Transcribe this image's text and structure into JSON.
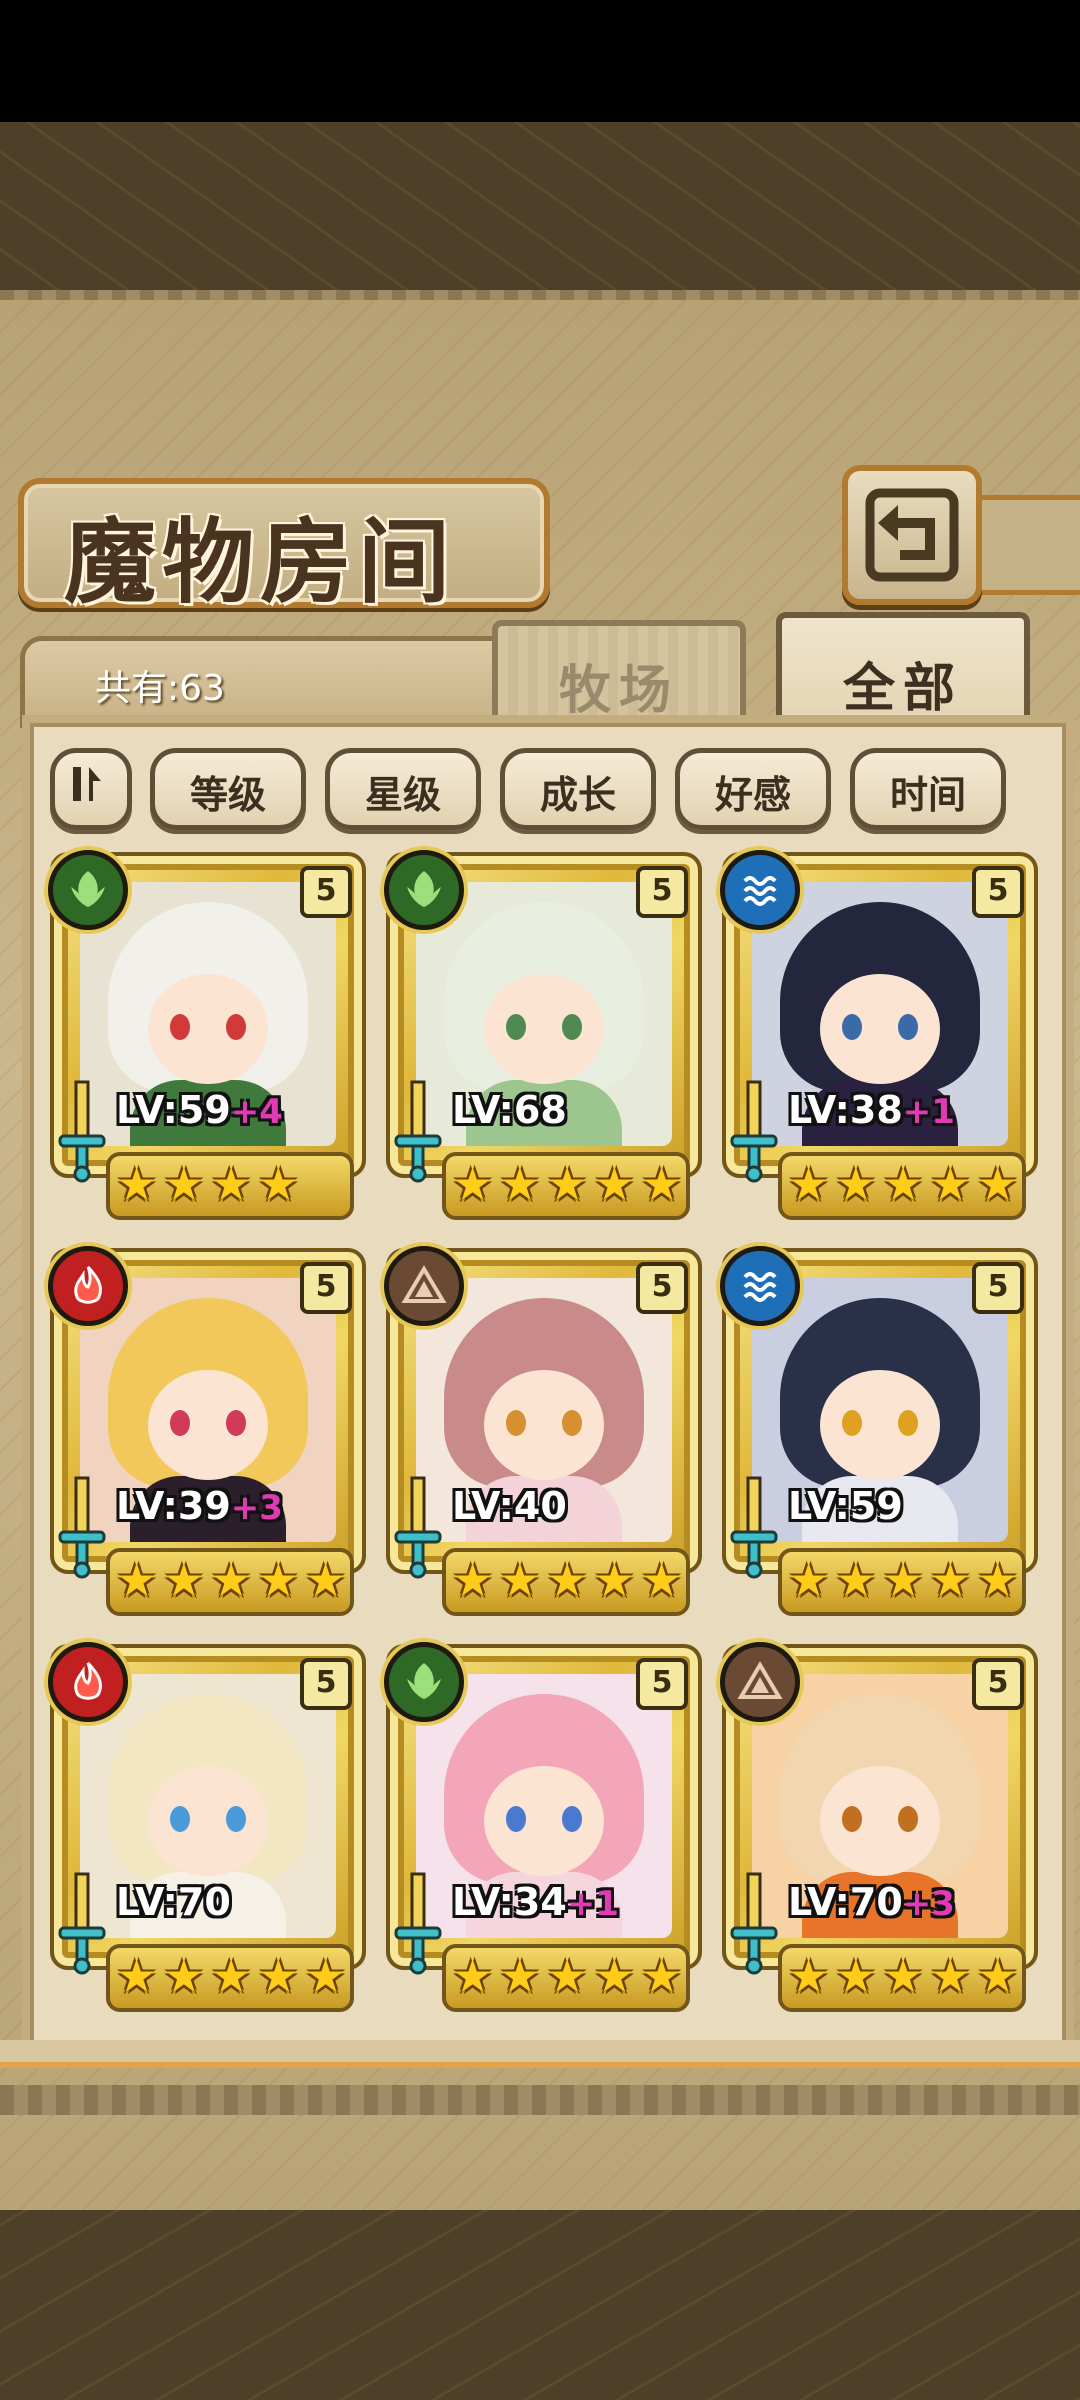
{
  "title": "魔物房间",
  "count": "共有:63",
  "tabs": [
    {
      "label": "牧场"
    },
    {
      "label": "全部"
    }
  ],
  "sort": {
    "order_icon": "sort-order-icon",
    "buttons": [
      "等级",
      "星级",
      "成长",
      "好感",
      "时间"
    ]
  },
  "monsters": [
    {
      "element": "nature",
      "rarity": "5",
      "lv": "LV:59",
      "plus": "+4",
      "stars": 4
    },
    {
      "element": "nature",
      "rarity": "5",
      "lv": "LV:68",
      "plus": "",
      "stars": 5
    },
    {
      "element": "water",
      "rarity": "5",
      "lv": "LV:38",
      "plus": "+1",
      "stars": 5
    },
    {
      "element": "fire",
      "rarity": "5",
      "lv": "LV:39",
      "plus": "+3",
      "stars": 5
    },
    {
      "element": "earth",
      "rarity": "5",
      "lv": "LV:40",
      "plus": "",
      "stars": 5
    },
    {
      "element": "water",
      "rarity": "5",
      "lv": "LV:59",
      "plus": "",
      "stars": 5
    },
    {
      "element": "fire",
      "rarity": "5",
      "lv": "LV:70",
      "plus": "",
      "stars": 5
    },
    {
      "element": "nature",
      "rarity": "5",
      "lv": "LV:34",
      "plus": "+1",
      "stars": 5
    },
    {
      "element": "earth",
      "rarity": "5",
      "lv": "LV:70",
      "plus": "+3",
      "stars": 5
    }
  ],
  "colors": {
    "nature": "#2e6a25",
    "water": "#1e6fb8",
    "fire": "#c02020",
    "earth": "#6b4a35",
    "accent": "#b27a2e"
  }
}
